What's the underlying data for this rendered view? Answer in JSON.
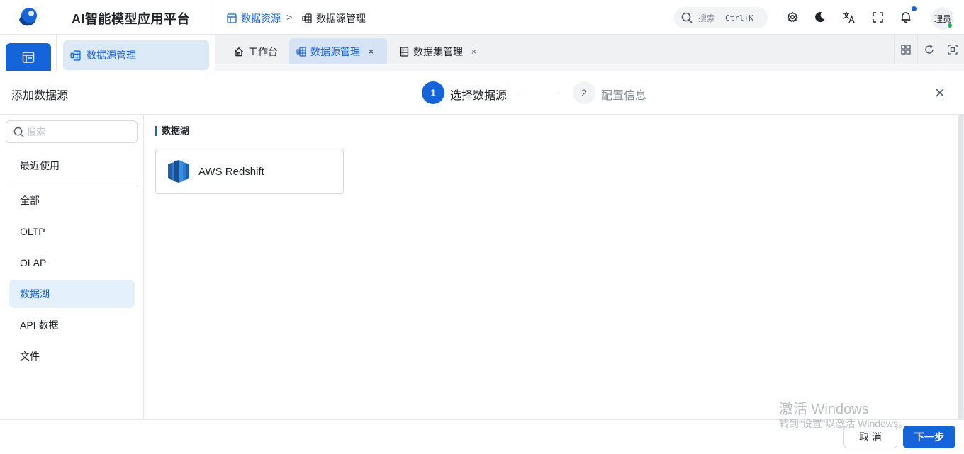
{
  "app": {
    "title": "AI智能模型应用平台"
  },
  "breadcrumb": {
    "parent": "数据资源",
    "separator": ">",
    "current": "数据源管理"
  },
  "topbar": {
    "search_label": "搜索",
    "search_shortcut": "Ctrl+K",
    "avatar_text": "理员",
    "icons": [
      "gear-icon",
      "moon-icon",
      "translate-icon",
      "fullscreen-icon",
      "bell-icon"
    ]
  },
  "side_menu": {
    "active_label": "数据源管理"
  },
  "tabs": [
    {
      "label": "工作台",
      "icon": "home-icon",
      "closable": false
    },
    {
      "label": "数据源管理",
      "icon": "database-icon",
      "closable": true,
      "close": "×"
    },
    {
      "label": "数据集管理",
      "icon": "table-icon",
      "closable": true,
      "close": "×"
    }
  ],
  "modal": {
    "title": "添加数据源",
    "close": "×",
    "steps": [
      {
        "number": "1",
        "label": "选择数据源",
        "active": true
      },
      {
        "number": "2",
        "label": "配置信息",
        "active": false
      }
    ],
    "search_placeholder": "搜索",
    "categories": [
      {
        "label": "最近使用",
        "active": false
      },
      {
        "label": "全部",
        "active": false
      },
      {
        "label": "OLTP",
        "active": false
      },
      {
        "label": "OLAP",
        "active": false
      },
      {
        "label": "数据湖",
        "active": true
      },
      {
        "label": "API 数据",
        "active": false
      },
      {
        "label": "文件",
        "active": false
      }
    ],
    "section_title": "数据湖",
    "sources": [
      {
        "name": "AWS Redshift",
        "icon": "aws-redshift-icon"
      }
    ],
    "cancel_label": "取 消",
    "next_label": "下一步"
  },
  "watermark": {
    "line1": "激活 Windows",
    "line2": "转到“设置”以激活 Windows。"
  },
  "colors": {
    "primary": "#1664d9",
    "active_bg": "#e4f1fc",
    "tab_active_bg": "#d5e3f4",
    "online": "#21b15e"
  }
}
